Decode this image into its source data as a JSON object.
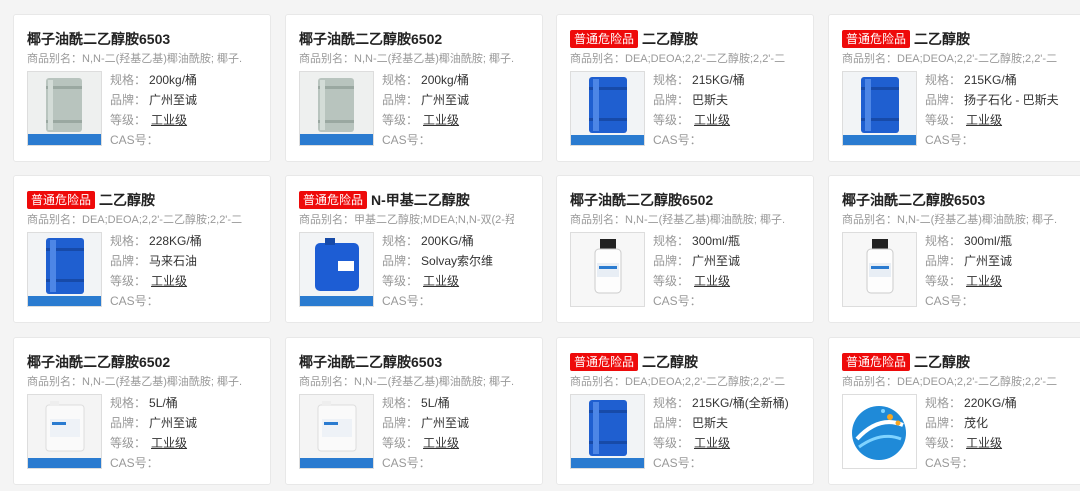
{
  "labels": {
    "spec": "规格：",
    "brand": "品牌：",
    "grade": "等级：",
    "cas": "CAS号：",
    "badge": "普通危险品"
  },
  "products": [
    {
      "title": "椰子油酰二乙醇胺6503",
      "hazard": false,
      "alias": "商品别名：N,N-二(羟基乙基)椰油酰胺; 椰子...",
      "spec": "200kg/桶",
      "brand": "广州至诚",
      "grade": "工业级",
      "image": "gray-drum"
    },
    {
      "title": "椰子油酰二乙醇胺6502",
      "hazard": false,
      "alias": "商品别名：N,N-二(羟基乙基)椰油酰胺; 椰子...",
      "spec": "200kg/桶",
      "brand": "广州至诚",
      "grade": "工业级",
      "image": "gray-drum"
    },
    {
      "title": "二乙醇胺",
      "hazard": true,
      "alias": "商品别名：DEA;DEOA;2,2'-二乙醇胺;2,2'-二...",
      "spec": "215KG/桶",
      "brand": "巴斯夫",
      "grade": "工业级",
      "image": "blue-drum"
    },
    {
      "title": "二乙醇胺",
      "hazard": true,
      "alias": "商品别名：DEA;DEOA;2,2'-二乙醇胺;2,2'-二...",
      "spec": "215KG/桶",
      "brand": "扬子石化 - 巴斯夫",
      "grade": "工业级",
      "image": "blue-drum"
    },
    {
      "title": "二乙醇胺",
      "hazard": true,
      "alias": "商品别名：DEA;DEOA;2,2'-二乙醇胺;2,2'-二...",
      "spec": "228KG/桶",
      "brand": "马来石油",
      "grade": "工业级",
      "image": "blue-drum"
    },
    {
      "title": "N-甲基二乙醇胺",
      "hazard": true,
      "alias": "商品别名：甲基二乙醇胺;MDEA;N,N-双(2-羟...",
      "spec": "200KG/桶",
      "brand": "Solvay索尔维",
      "grade": "工业级",
      "image": "blue-barrel"
    },
    {
      "title": "椰子油酰二乙醇胺6502",
      "hazard": false,
      "alias": "商品别名：N,N-二(羟基乙基)椰油酰胺; 椰子...",
      "spec": "300ml/瓶",
      "brand": "广州至诚",
      "grade": "工业级",
      "image": "bottle"
    },
    {
      "title": "椰子油酰二乙醇胺6503",
      "hazard": false,
      "alias": "商品别名：N,N-二(羟基乙基)椰油酰胺; 椰子...",
      "spec": "300ml/瓶",
      "brand": "广州至诚",
      "grade": "工业级",
      "image": "bottle"
    },
    {
      "title": "椰子油酰二乙醇胺6502",
      "hazard": false,
      "alias": "商品别名：N,N-二(羟基乙基)椰油酰胺; 椰子...",
      "spec": "5L/桶",
      "brand": "广州至诚",
      "grade": "工业级",
      "image": "white-jug"
    },
    {
      "title": "椰子油酰二乙醇胺6503",
      "hazard": false,
      "alias": "商品别名：N,N-二(羟基乙基)椰油酰胺; 椰子...",
      "spec": "5L/桶",
      "brand": "广州至诚",
      "grade": "工业级",
      "image": "white-jug"
    },
    {
      "title": "二乙醇胺",
      "hazard": true,
      "alias": "商品别名：DEA;DEOA;2,2'-二乙醇胺;2,2'-二...",
      "spec": "215KG/桶(全新桶)",
      "brand": "巴斯夫",
      "grade": "工业级",
      "image": "blue-drum"
    },
    {
      "title": "二乙醇胺",
      "hazard": true,
      "alias": "商品别名：DEA;DEOA;2,2'-二乙醇胺;2,2'-二...",
      "spec": "220KG/桶",
      "brand": "茂化",
      "grade": "工业级",
      "image": "logo"
    }
  ]
}
